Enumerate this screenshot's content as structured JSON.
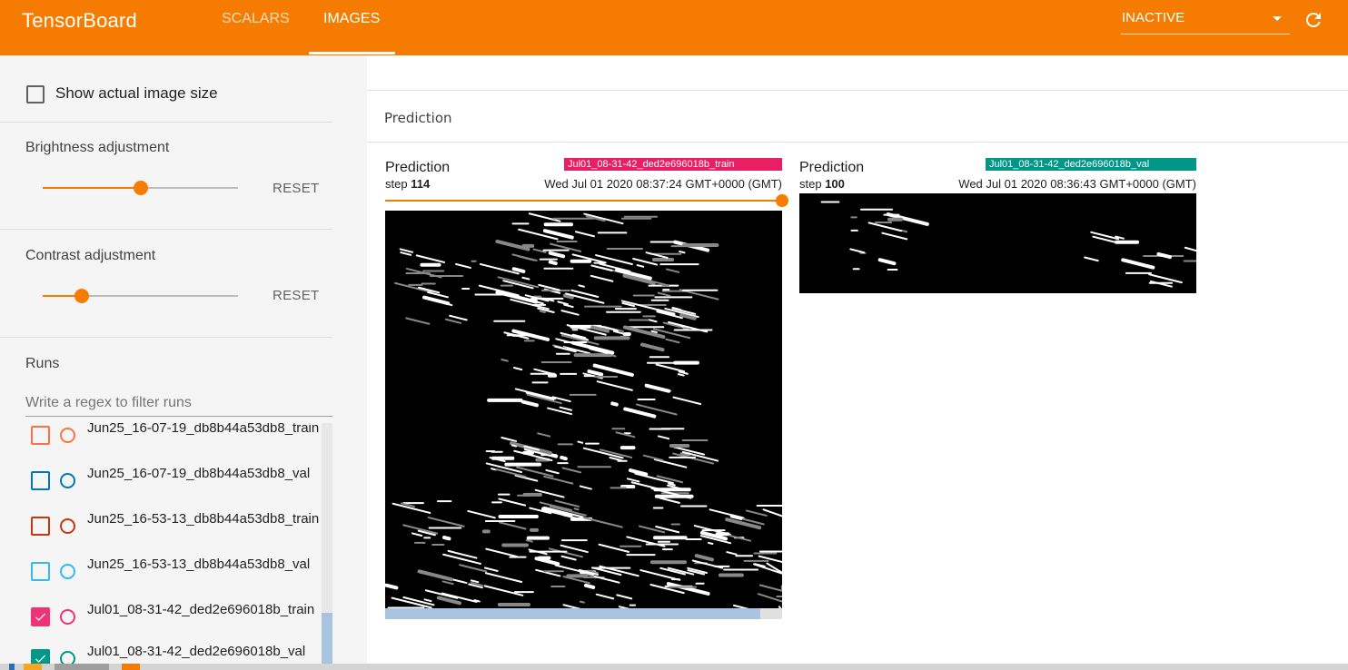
{
  "app": {
    "title": "TensorBoard"
  },
  "nav": {
    "tabs": [
      {
        "label": "SCALARS",
        "active": false
      },
      {
        "label": "IMAGES",
        "active": true
      }
    ]
  },
  "status": {
    "value": "INACTIVE"
  },
  "icons": {
    "reload": "reload-icon",
    "dropdown": "chevron-down-icon"
  },
  "colors": {
    "accent": "#f57c00",
    "train_chip": "#e91e63",
    "val_chip": "#009688"
  },
  "sidebar": {
    "show_actual_size": {
      "label": "Show actual image size",
      "checked": false
    },
    "brightness": {
      "label": "Brightness adjustment",
      "reset": "RESET",
      "level": 0.5
    },
    "contrast": {
      "label": "Contrast adjustment",
      "reset": "RESET",
      "level": 0.2
    },
    "runs": {
      "title": "Runs",
      "filter_placeholder": "Write a regex to filter runs",
      "items": [
        {
          "name": "Jun25_16-07-19_db8b44a53db8_train",
          "color": "#ff7043",
          "checked": false
        },
        {
          "name": "Jun25_16-07-19_db8b44a53db8_val",
          "color": "#0077bb",
          "checked": false
        },
        {
          "name": "Jun25_16-53-13_db8b44a53db8_train",
          "color": "#cc3311",
          "checked": false
        },
        {
          "name": "Jun25_16-53-13_db8b44a53db8_val",
          "color": "#33bbee",
          "checked": false
        },
        {
          "name": "Jul01_08-31-42_ded2e696018b_train",
          "color": "#ee3377",
          "checked": true
        },
        {
          "name": "Jul01_08-31-42_ded2e696018b_val",
          "color": "#009988",
          "checked": true
        }
      ]
    }
  },
  "main": {
    "group_title": "Prediction",
    "cards": [
      {
        "title": "Prediction",
        "run": "Jul01_08-31-42_ded2e696018b_train",
        "step_label": "step",
        "step": "114",
        "time": "Wed Jul 01 2020 08:37:24 GMT+0000 (GMT)",
        "step_position": 1.0
      },
      {
        "title": "Prediction",
        "run": "Jul01_08-31-42_ded2e696018b_val",
        "step_label": "step",
        "step": "100",
        "time": "Wed Jul 01 2020 08:36:43 GMT+0000 (GMT)"
      }
    ]
  }
}
